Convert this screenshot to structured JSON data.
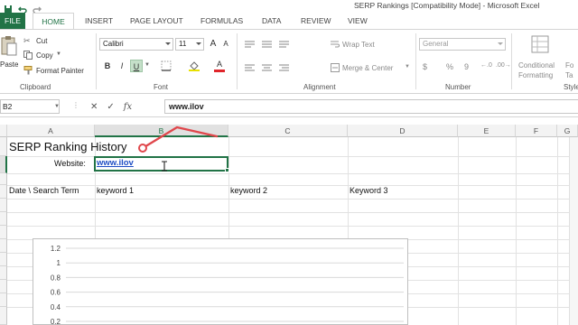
{
  "window": {
    "title": "SERP Rankings  [Compatibility Mode] - Microsoft Excel"
  },
  "ribbon_tabs": [
    "FILE",
    "HOME",
    "INSERT",
    "PAGE LAYOUT",
    "FORMULAS",
    "DATA",
    "REVIEW",
    "VIEW"
  ],
  "clipboard": {
    "paste": "Paste",
    "cut": "Cut",
    "copy": "Copy",
    "format_painter": "Format Painter",
    "group_label": "Clipboard"
  },
  "font": {
    "family": "Calibri",
    "size": "11",
    "bold": "B",
    "italic": "I",
    "underline": "U",
    "group_label": "Font",
    "grow": "A",
    "shrink": "A",
    "color_a": "A"
  },
  "alignment": {
    "wrap_text": "Wrap Text",
    "merge_center": "Merge & Center",
    "group_label": "Alignment"
  },
  "number": {
    "format": "General",
    "currency": "$",
    "percent": "%",
    "comma": "9",
    "group_label": "Number"
  },
  "styles": {
    "conditional_line1": "Conditional",
    "conditional_line2": "Formatting",
    "format_as_line1": "Fo",
    "format_as_line2": "Ta",
    "group_label": "Style"
  },
  "formula_bar": {
    "name_box": "B2",
    "cancel": "✕",
    "enter": "✓",
    "fx": "fx",
    "value": "www.ilov"
  },
  "columns": [
    "A",
    "B",
    "C",
    "D",
    "E",
    "F",
    "G"
  ],
  "cells": {
    "title": "SERP Ranking History",
    "website_label": "Website:",
    "website_value": "www.ilov",
    "header_date": "Date \\ Search Term",
    "header_kw1": "keyword 1",
    "header_kw2": "keyword 2",
    "header_kw3": "Keyword 3"
  },
  "chart_data": {
    "type": "line",
    "y_ticks": [
      "1.2",
      "1",
      "0.8",
      "0.6",
      "0.4",
      "0.2"
    ],
    "ylim": [
      0,
      1.2
    ],
    "grid": true,
    "series": []
  },
  "colors": {
    "excel_green": "#217346",
    "annotation_red": "#e0474c",
    "link_blue": "#1f4ec4"
  }
}
